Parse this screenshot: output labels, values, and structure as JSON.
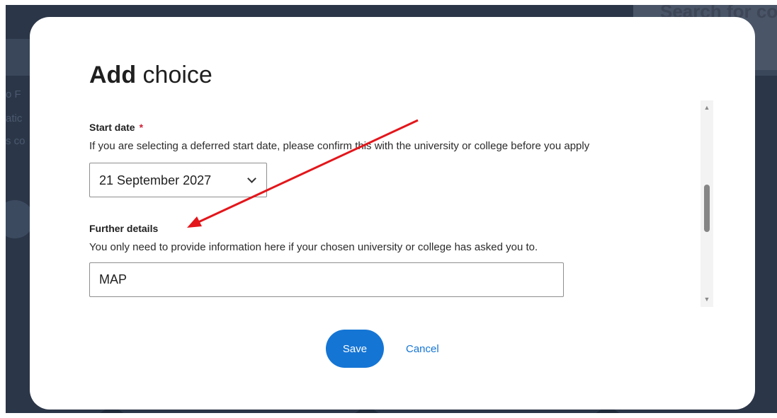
{
  "background": {
    "search_title": "Search for co",
    "side_text": [
      "o F",
      "atic",
      "s co"
    ]
  },
  "modal": {
    "title_bold": "Add",
    "title_rest": "choice",
    "start_date": {
      "label": "Start date",
      "required_mark": "*",
      "hint": "If you are selecting a deferred start date, please confirm this with the university or college before you apply",
      "selected": "21 September 2027"
    },
    "further_details": {
      "label": "Further details",
      "hint": "You only need to provide information here if your chosen university or college has asked you to.",
      "value": "MAP"
    },
    "scrollbar": {
      "up_icon": "triangle-up-icon",
      "down_icon": "triangle-down-icon"
    },
    "save_label": "Save",
    "cancel_label": "Cancel"
  },
  "colors": {
    "primary": "#1575d4",
    "required": "#d11f36",
    "annotation_arrow": "#e3161b",
    "backdrop": "#2b3648"
  }
}
